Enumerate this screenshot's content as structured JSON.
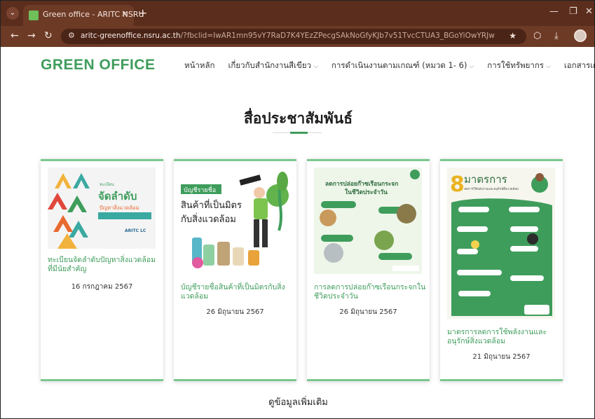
{
  "browser": {
    "tab_title": "Green office - ARITC NSRU",
    "new_tab": "+",
    "url_host": "aritc-greenoffice.nsru.ac.th",
    "url_rest": "/?fbclid=IwAR1mn95vY7RaD7K4YEzZPecgSAkNoGfyKJb7v51TvcCTUA3_BGoYiOwYRJw"
  },
  "site": {
    "logo": "GREEN OFFICE",
    "nav": [
      {
        "label": "หน้าหลัก",
        "has_dropdown": false
      },
      {
        "label": "เกี่ยวกับสำนักงานสีเขียว",
        "has_dropdown": true
      },
      {
        "label": "การดำเนินงานตามเกณฑ์ (หมวด 1- 6)",
        "has_dropdown": true
      },
      {
        "label": "การใช้ทรัพยากร",
        "has_dropdown": true
      },
      {
        "label": "เอกสารเผยแพร่",
        "has_dropdown": false
      }
    ]
  },
  "section": {
    "title": "สื่อประชาสัมพันธ์",
    "more_label": "ดูข้อมูลเพิ่มเติม"
  },
  "cards": [
    {
      "title": "ทะเบียนจัดลำดับปัญหาสิ่งแวดล้อมที่มีนัยสำคัญ",
      "date": "16 กรกฎาคม 2567",
      "thumb_texts": {
        "small": "ทะเบียน",
        "big": "จัดลำดับ",
        "sub": "ปัญหาสิ่งแวดล้อม",
        "brand": "ARITC LC"
      }
    },
    {
      "title": "บัญชีรายชื่อสินค้าที่เป็นมิตรกับสิ่งแวดล้อม",
      "date": "26 มิถุนายน 2567",
      "thumb_texts": {
        "tag": "บัญชีรายชื่อ",
        "line1": "สินค้าที่เป็นมิตร",
        "line2": "กับสิ่งแวดล้อม"
      }
    },
    {
      "title": "การลดการปล่อยก๊าซเรือนกระจกในชีวิตประจำวัน",
      "date": "26 มิถุนายน 2567",
      "thumb_texts": {
        "line1": "ลดการปล่อยก๊าซเรือนกระจก",
        "line2": "ในชีวิตประจำวัน"
      }
    },
    {
      "title": "มาตรการลดการใช้พลังงานและอนุรักษ์สิ่งแวดล้อม",
      "date": "21 มิถุนายน 2567",
      "thumb_texts": {
        "big": "มาตรการ",
        "sub": "ลดการใช้พลังงานและอนุรักษ์สิ่งแวดล้อม"
      }
    }
  ],
  "colors": {
    "brand_green": "#3f9d5c",
    "chrome_brown": "#6d3a26"
  }
}
